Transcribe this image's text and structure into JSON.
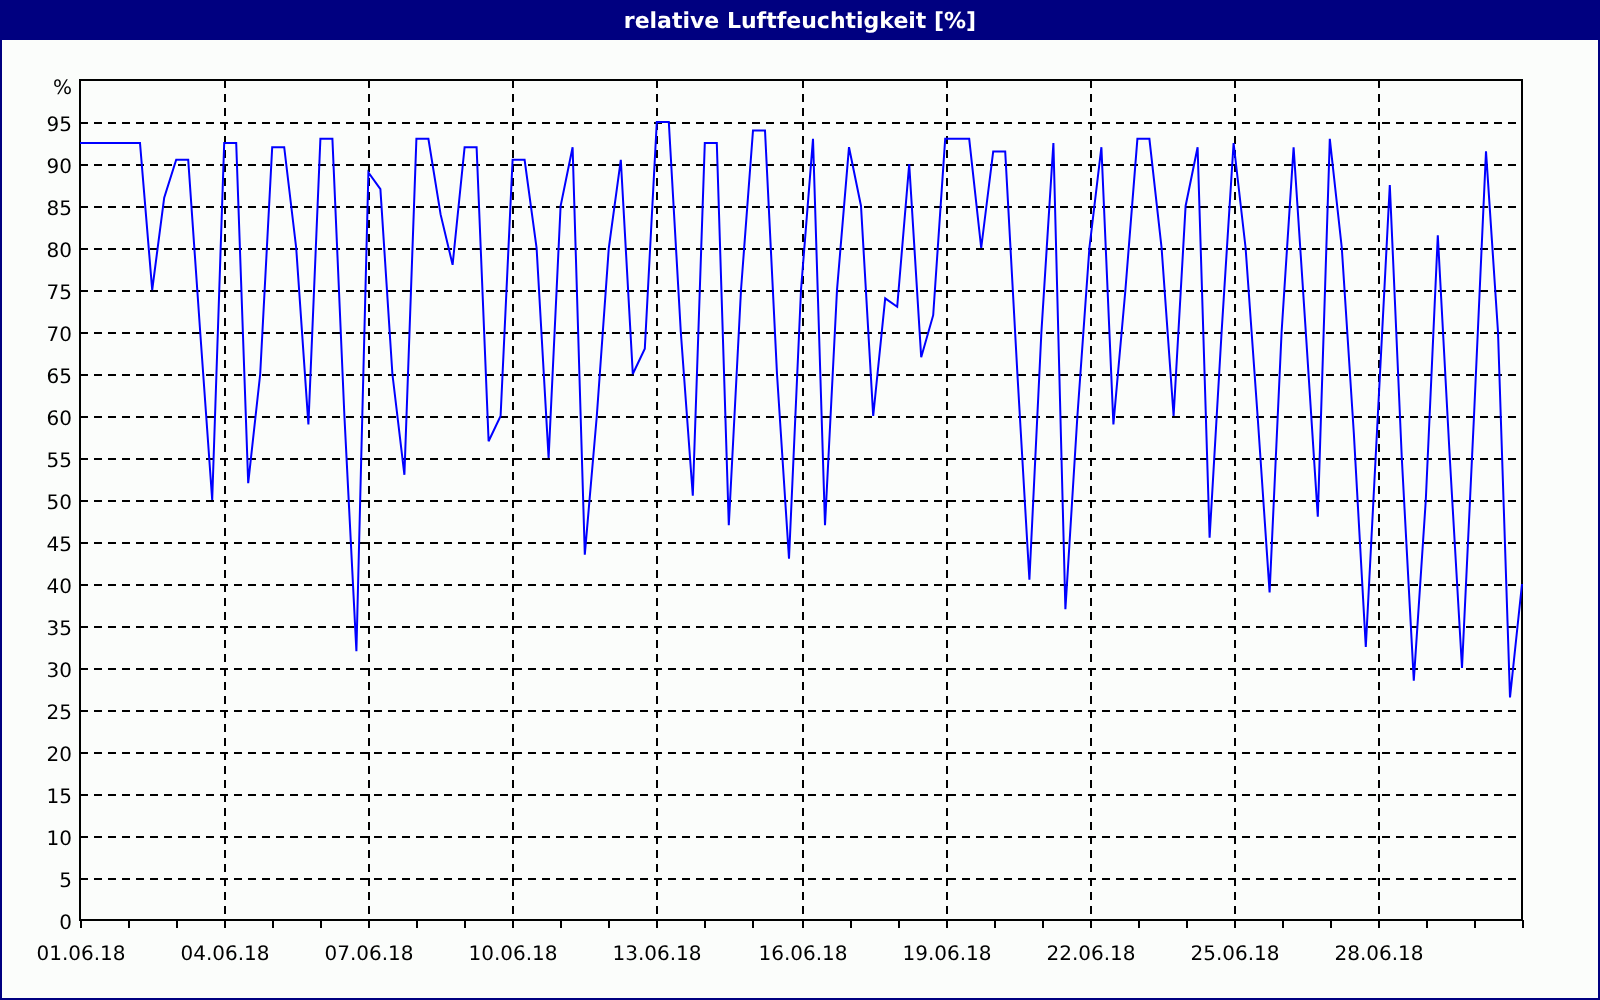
{
  "chart": {
    "chart_data": {
      "type": "line",
      "title": "relative Luftfeuchtigkeit [%]",
      "ylabel": "%",
      "grid": true,
      "ylim": [
        0,
        100
      ],
      "yticks": [
        0,
        5,
        10,
        15,
        20,
        25,
        30,
        35,
        40,
        45,
        50,
        55,
        60,
        65,
        70,
        75,
        80,
        85,
        90,
        95
      ],
      "categories": [
        "01.06.18",
        null,
        null,
        null,
        null,
        null,
        null,
        null,
        null,
        null,
        null,
        null,
        "04.06.18",
        null,
        null,
        null,
        null,
        null,
        null,
        null,
        null,
        null,
        null,
        null,
        "07.06.18",
        null,
        null,
        null,
        null,
        null,
        null,
        null,
        null,
        null,
        null,
        null,
        "10.06.18",
        null,
        null,
        null,
        null,
        null,
        null,
        null,
        null,
        null,
        null,
        null,
        "13.06.18",
        null,
        null,
        null,
        null,
        null,
        null,
        null,
        null,
        null,
        null,
        null,
        "16.06.18",
        null,
        null,
        null,
        null,
        null,
        null,
        null,
        null,
        null,
        null,
        null,
        "19.06.18",
        null,
        null,
        null,
        null,
        null,
        null,
        null,
        null,
        null,
        null,
        null,
        "22.06.18",
        null,
        null,
        null,
        null,
        null,
        null,
        null,
        null,
        null,
        null,
        null,
        "25.06.18",
        null,
        null,
        null,
        null,
        null,
        null,
        null,
        null,
        null,
        null,
        null,
        "28.06.18",
        null,
        null,
        null,
        null,
        null,
        null,
        null,
        null,
        null,
        null,
        null,
        null
      ],
      "series": [
        {
          "color": "#0000ff",
          "values": [
            92.5,
            92.5,
            92.5,
            92.5,
            92.5,
            92.5,
            75,
            86,
            90.5,
            90.5,
            70,
            50,
            92.5,
            92.5,
            52,
            65,
            92,
            92,
            80,
            59,
            93,
            93,
            60,
            32,
            89,
            87,
            65,
            53,
            93,
            93,
            84,
            78,
            92,
            92,
            57,
            60,
            90.5,
            90.5,
            80,
            55,
            85,
            92,
            43.5,
            60,
            80,
            90.5,
            65,
            68,
            95,
            95,
            70,
            50.5,
            92.5,
            92.5,
            47,
            75,
            94,
            94,
            65,
            43,
            75,
            93,
            47,
            75,
            92,
            85,
            60,
            74,
            73,
            90,
            67,
            72,
            93,
            93,
            93,
            80,
            91.5,
            91.5,
            65,
            40.5,
            70,
            92.5,
            37,
            60,
            80,
            92,
            59,
            75,
            93,
            93,
            80,
            60,
            85,
            92,
            45.5,
            70,
            92.5,
            80,
            60,
            39,
            70,
            92,
            70,
            48,
            93,
            80,
            58,
            32.5,
            60,
            87.5,
            55,
            28.5,
            50,
            81.5,
            55,
            30,
            60,
            91.5,
            70,
            26.5,
            40
          ]
        }
      ]
    }
  }
}
